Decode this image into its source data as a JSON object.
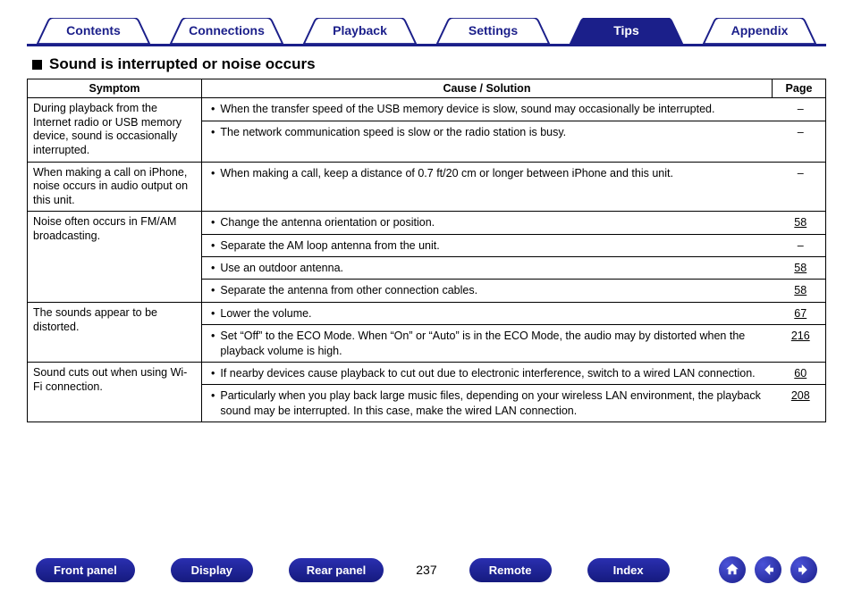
{
  "tabs": [
    "Contents",
    "Connections",
    "Playback",
    "Settings",
    "Tips",
    "Appendix"
  ],
  "active_tab_index": 4,
  "heading": "Sound is interrupted or noise occurs",
  "table": {
    "headers": {
      "symptom": "Symptom",
      "solution": "Cause / Solution",
      "page": "Page"
    },
    "rows": [
      {
        "symptom": "During playback from the Internet radio or USB memory device, sound is occasionally interrupted.",
        "items": [
          {
            "text": "When the transfer speed of the USB memory device is slow, sound may occasionally be interrupted.",
            "page": "–"
          },
          {
            "text": "The network communication speed is slow or the radio station is busy.",
            "page": "–"
          }
        ]
      },
      {
        "symptom": "When making a call on iPhone, noise occurs in audio output on this unit.",
        "items": [
          {
            "text": "When making a call, keep a distance of 0.7 ft/20 cm or longer between iPhone and this unit.",
            "page": "–"
          }
        ]
      },
      {
        "symptom": "Noise often occurs in FM/AM broadcasting.",
        "items": [
          {
            "text": "Change the antenna orientation or position.",
            "page": "58"
          },
          {
            "text": "Separate the AM loop antenna from the unit.",
            "page": "–"
          },
          {
            "text": "Use an outdoor antenna.",
            "page": "58"
          },
          {
            "text": "Separate the antenna from other connection cables.",
            "page": "58"
          }
        ]
      },
      {
        "symptom": "The sounds appear to be distorted.",
        "items": [
          {
            "text": "Lower the volume.",
            "page": "67"
          },
          {
            "text": "Set “Off” to the ECO Mode. When “On” or “Auto” is in the ECO Mode, the audio may by distorted when the playback volume is high.",
            "page": "216"
          }
        ]
      },
      {
        "symptom": "Sound cuts out when using Wi-Fi connection.",
        "items": [
          {
            "text": "If nearby devices cause playback to cut out due to electronic interference, switch to a wired LAN connection.",
            "page": "60"
          },
          {
            "text": "Particularly when you play back large music files, depending on your wireless LAN environment, the playback sound may be interrupted. In this case, make the wired LAN connection.",
            "page": "208"
          }
        ]
      }
    ]
  },
  "bottom": {
    "buttons_left": [
      "Front panel",
      "Display",
      "Rear panel"
    ],
    "page_number": "237",
    "buttons_right": [
      "Remote",
      "Index"
    ]
  }
}
